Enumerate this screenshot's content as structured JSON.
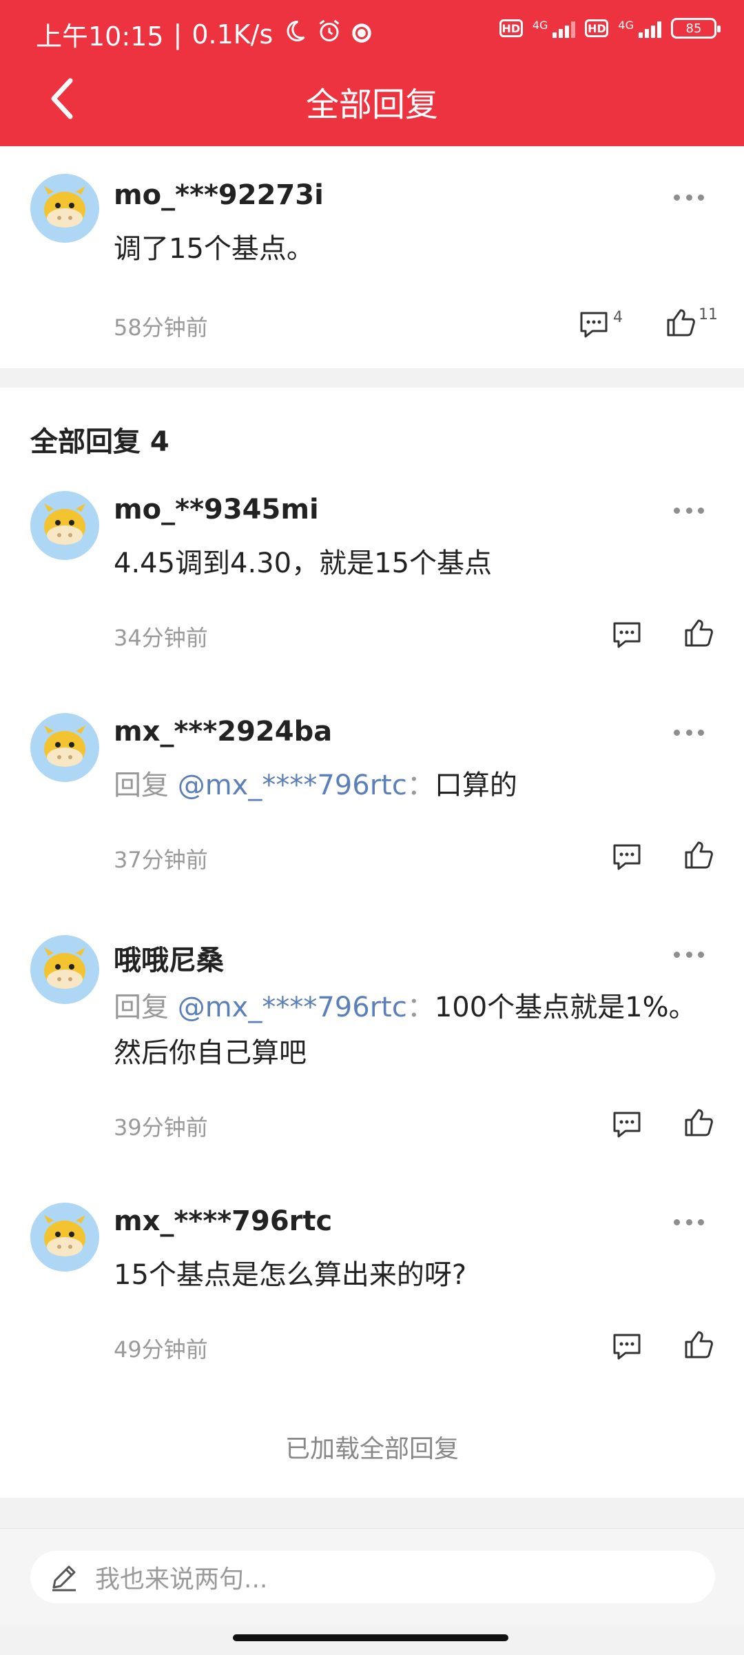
{
  "status_bar": {
    "time": "上午10:15",
    "speed": "0.1K/s",
    "network1": "4G",
    "network2": "4G",
    "hd1": "HD",
    "hd2": "HD",
    "battery": "85"
  },
  "header": {
    "title": "全部回复"
  },
  "top_comment": {
    "username": "mo_***92273i",
    "text": "调了15个基点。",
    "time": "58分钟前",
    "comment_count": "4",
    "like_count": "11"
  },
  "replies": {
    "section_title": "全部回复 4",
    "items": [
      {
        "username": "mo_**9345mi",
        "prefix": "",
        "mention": "",
        "text": "4.45调到4.30，就是15个基点",
        "time": "34分钟前"
      },
      {
        "username": "mx_***2924ba",
        "prefix": "回复 ",
        "mention": "@mx_****796rtc",
        "sep": "：",
        "text": "口算的",
        "time": "37分钟前"
      },
      {
        "username": "哦哦尼桑",
        "prefix": "回复 ",
        "mention": "@mx_****796rtc",
        "sep": "：",
        "text": "100个基点就是1%。然后你自己算吧",
        "time": "39分钟前"
      },
      {
        "username": "mx_****796rtc",
        "prefix": "",
        "mention": "",
        "text": "15个基点是怎么算出来的呀?",
        "time": "49分钟前"
      }
    ],
    "loaded_text": "已加载全部回复"
  },
  "input": {
    "placeholder": "我也来说两句..."
  },
  "colors": {
    "brand": "#ee3340",
    "mention": "#5b7fb8"
  }
}
